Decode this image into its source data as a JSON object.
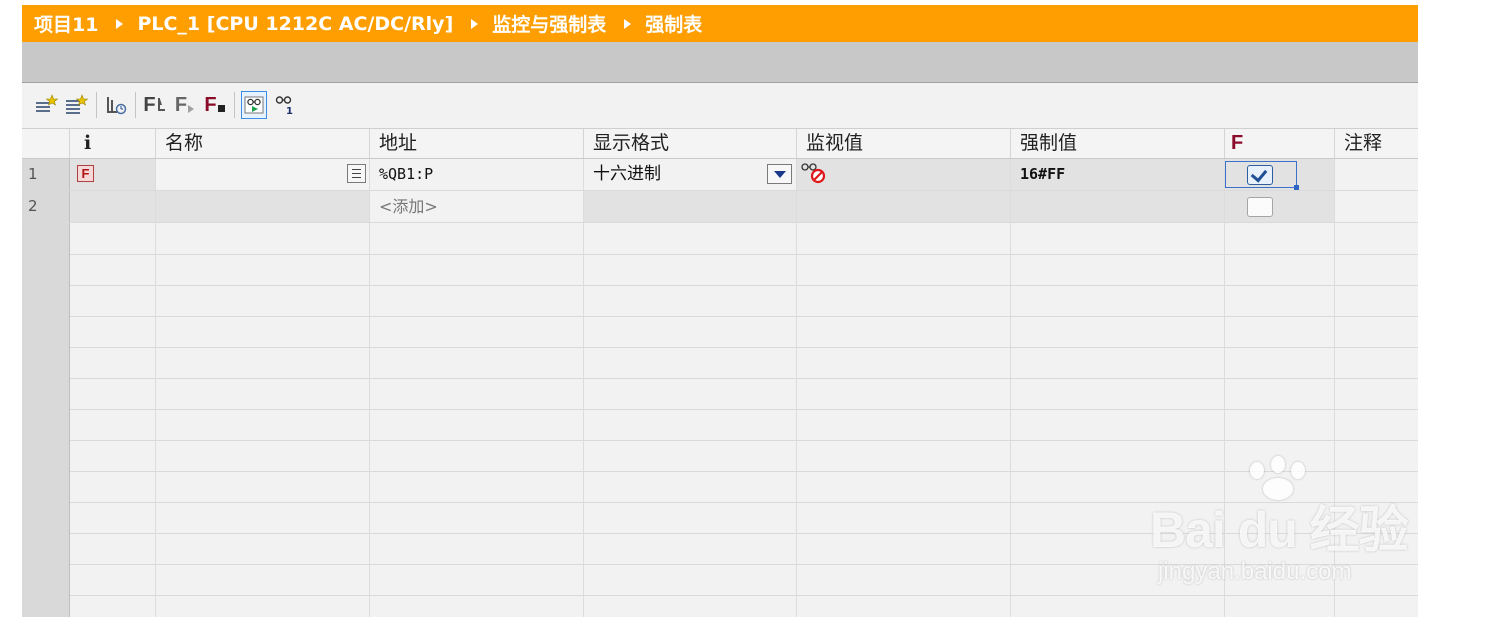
{
  "breadcrumb": [
    "项目11",
    "PLC_1 [CPU 1212C AC/DC/Rly]",
    "监控与强制表",
    "强制表"
  ],
  "toolbar": {
    "buttons": [
      {
        "name": "insert-row-icon"
      },
      {
        "name": "add-row-icon"
      },
      {
        "name": "monitor-once-icon"
      },
      {
        "name": "force-f-icon",
        "glyph": "F"
      },
      {
        "name": "force-start-icon",
        "glyph": "F"
      },
      {
        "name": "force-stop-icon",
        "glyph": "F"
      },
      {
        "name": "monitor-all-icon",
        "active": true
      },
      {
        "name": "monitor-once-glasses-icon"
      }
    ]
  },
  "table": {
    "headers": {
      "info": "i",
      "name": "名称",
      "address": "地址",
      "format": "显示格式",
      "monitor": "监视值",
      "force_value": "强制值",
      "force": "F",
      "comment": "注释"
    },
    "rows": [
      {
        "num": "1",
        "status_icon": "F",
        "name": "",
        "address": "%QB1:P",
        "format": "十六进制",
        "monitor": "",
        "force_value": "16#FF",
        "force_checked": true,
        "comment": ""
      },
      {
        "num": "2",
        "name": "",
        "address": "<添加>",
        "format": "",
        "monitor": "",
        "force_value": "",
        "force_checked": false,
        "comment": ""
      }
    ]
  },
  "watermark": {
    "logo": "Bai du 经验",
    "url": "jingyan.baidu.com"
  },
  "colors": {
    "titlebar": "#ff9e00",
    "accent": "#3b72c9",
    "force_red": "#8b0b2a"
  }
}
